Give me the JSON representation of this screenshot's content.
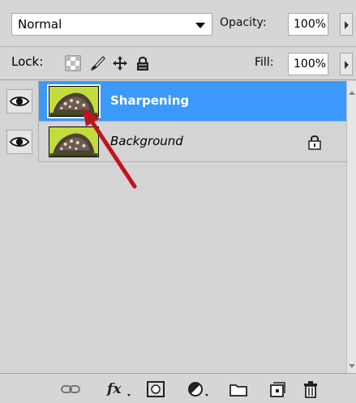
{
  "top": {
    "blend_mode": "Normal",
    "opacity_label": "Opacity:",
    "opacity_value": "100%"
  },
  "lock": {
    "label": "Lock:",
    "fill_label": "Fill:",
    "fill_value": "100%"
  },
  "layers": [
    {
      "name": "Sharpening",
      "selected": true,
      "visible": true,
      "locked": false
    },
    {
      "name": "Background",
      "selected": false,
      "visible": true,
      "locked": true
    }
  ],
  "bottom_icons": [
    "link-icon",
    "fx-icon",
    "layer-mask-icon",
    "adjustment-layer-icon",
    "group-folder-icon",
    "new-layer-icon",
    "trash-icon"
  ],
  "colors": {
    "selection": "#3b99fc",
    "panel": "#d4d4d4",
    "annotation_arrow": "#c0141c"
  }
}
